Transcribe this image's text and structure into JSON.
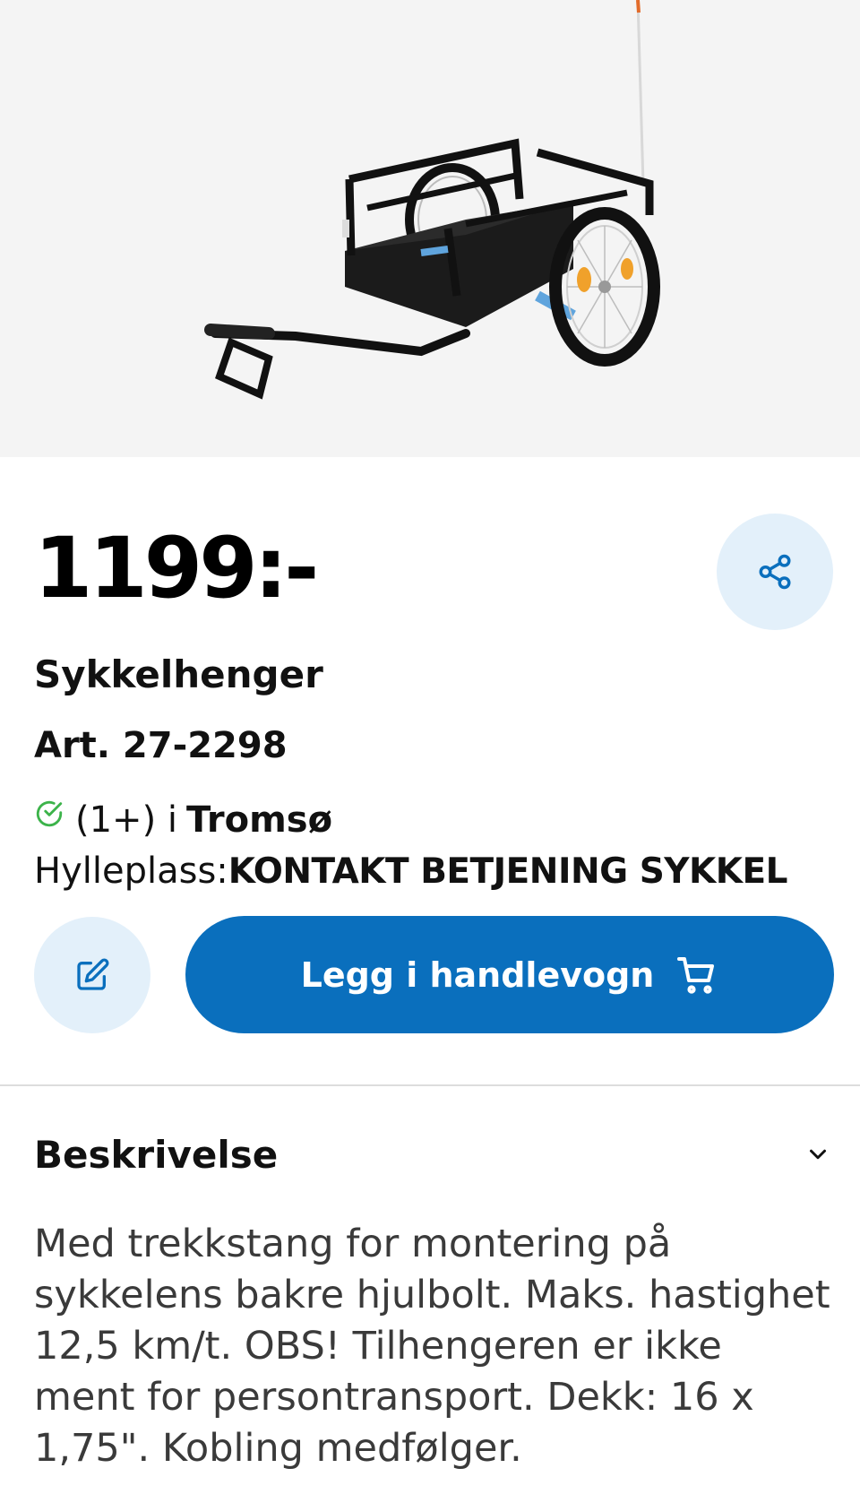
{
  "product": {
    "price": "1199:-",
    "title": "Sykkelhenger",
    "article": "Art. 27-2298",
    "stock": {
      "count": "(1+) i",
      "city": "Tromsø",
      "status_icon": "check-circle-icon"
    },
    "shelf": {
      "label": "Hylleplass:",
      "value": "KONTAKT BETJENING SYKKEL"
    }
  },
  "actions": {
    "share_icon": "share-icon",
    "edit_icon": "edit-icon",
    "add_to_cart_label": "Legg i handlevogn",
    "cart_icon": "shopping-cart-icon"
  },
  "description": {
    "heading": "Beskrivelse",
    "expand_icon": "chevron-down-icon",
    "text": "Med trekkstang for montering på sykkelens bakre hjulbolt. Maks. hastighet 12,5 km/t. OBS! Tilhengeren er ikke ment for persontransport. Dekk: 16 x 1,75\". Kobling medfølger."
  },
  "colors": {
    "primary": "#0a6fbd",
    "icon_button_bg": "#e3f0fa",
    "in_stock": "#3cb34a",
    "hero_bg": "#f4f4f4"
  }
}
